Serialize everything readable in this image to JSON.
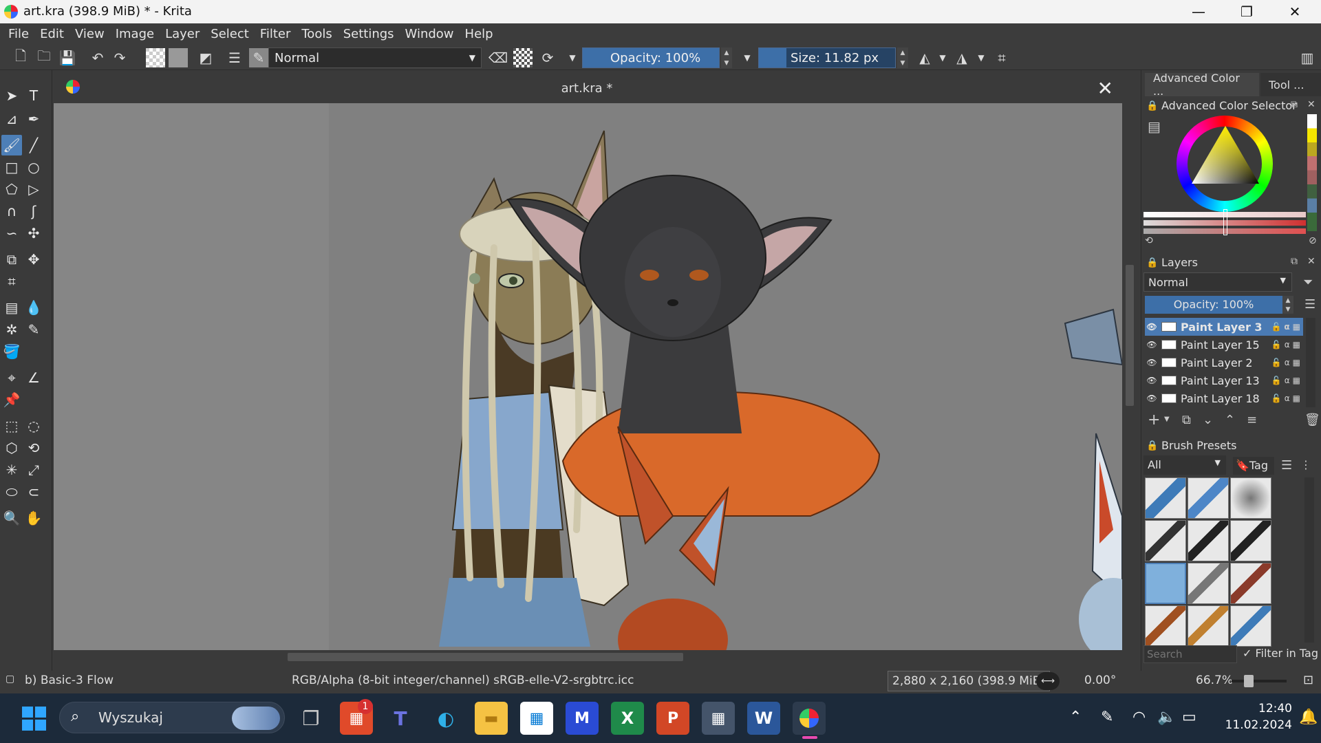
{
  "window": {
    "title": "art.kra (398.9 MiB)  * - Krita",
    "controls": {
      "minimize": "—",
      "restore": "❐",
      "close": "✕"
    }
  },
  "menu": {
    "items": [
      {
        "label": "File"
      },
      {
        "label": "Edit"
      },
      {
        "label": "View"
      },
      {
        "label": "Image"
      },
      {
        "label": "Layer"
      },
      {
        "label": "Select"
      },
      {
        "label": "Filter"
      },
      {
        "label": "Tools"
      },
      {
        "label": "Settings"
      },
      {
        "label": "Window"
      },
      {
        "label": "Help"
      }
    ]
  },
  "tool_options": {
    "blend_mode": "Normal",
    "opacity_label": "Opacity: 100%",
    "opacity_value": 1.0,
    "size_label": "Size: 11.82 px",
    "size_value": 0.06
  },
  "document": {
    "tab_title": "art.kra *",
    "close_icon": "✕"
  },
  "dockers": {
    "tabs": [
      "Advanced Color ...",
      "Tool ..."
    ],
    "color_selector_title": "Advanced Color Selector",
    "layers_title": "Layers",
    "layers_blend_mode": "Normal",
    "layers_opacity_label": "Opacity:  100%",
    "layers": [
      {
        "name": "Paint Layer 3",
        "active": true
      },
      {
        "name": "Paint Layer 15",
        "active": false
      },
      {
        "name": "Paint Layer 2",
        "active": false
      },
      {
        "name": "Paint Layer 13",
        "active": false
      },
      {
        "name": "Paint Layer 18",
        "active": false
      }
    ],
    "brush_presets_title": "Brush Presets",
    "brush_filter": "All",
    "tag_label": "Tag",
    "search_placeholder": "Search",
    "filter_in_tag_label": "Filter in Tag",
    "filter_in_tag_checked": true
  },
  "status": {
    "brush": "b) Basic-3 Flow",
    "color_space": "RGB/Alpha (8-bit integer/channel)  sRGB-elle-V2-srgbtrc.icc",
    "dimensions": "2,880 x 2,160 (398.9 MiB)",
    "rotation": "0.00°",
    "zoom": "66.7%"
  },
  "taskbar": {
    "search_label": "Wyszukaj",
    "notification_badge": "1",
    "time": "12:40",
    "date": "11.02.2024"
  },
  "colors": {
    "accent": "#4d7fb7",
    "canvas_bg": "#808080",
    "panel_bg": "#3a3a3a",
    "taskbar_bg": "#1c2a3a",
    "orange_shirt": "#d9692a",
    "fur_dark": "#3b3b3d"
  }
}
